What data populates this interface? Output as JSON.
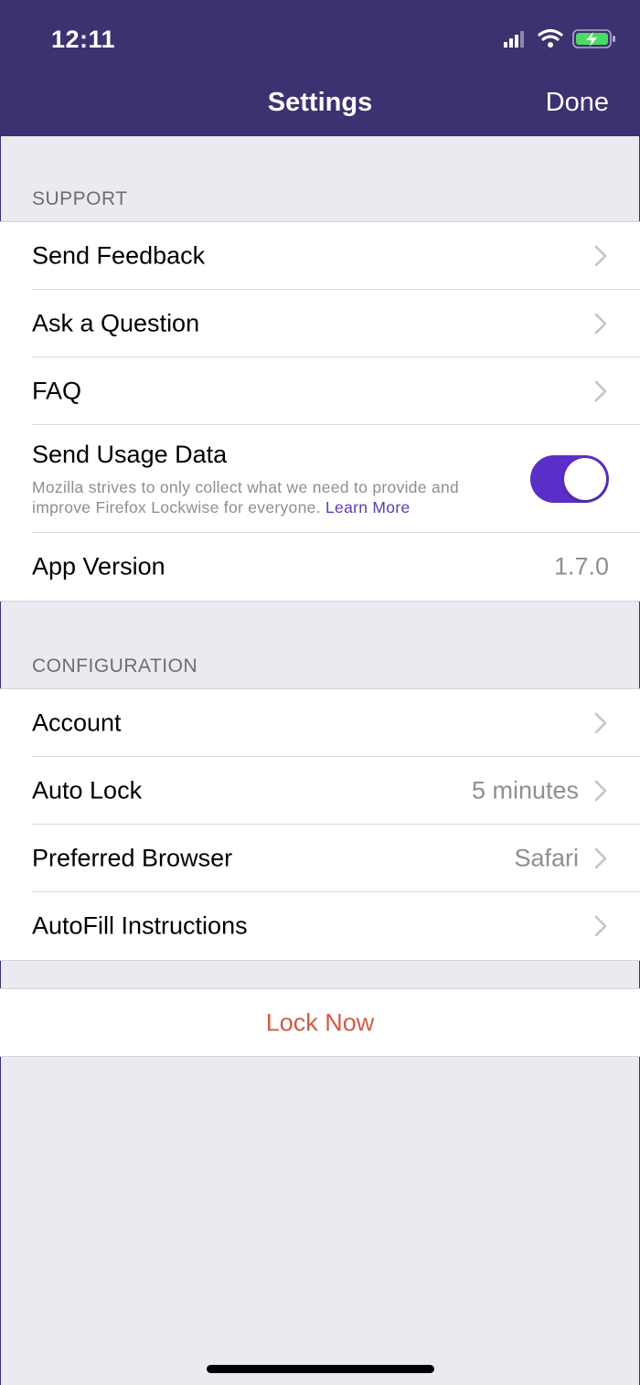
{
  "status_bar": {
    "time": "12:11"
  },
  "nav": {
    "title": "Settings",
    "done_label": "Done"
  },
  "support": {
    "header": "SUPPORT",
    "items": [
      {
        "label": "Send Feedback"
      },
      {
        "label": "Ask a Question"
      },
      {
        "label": "FAQ"
      }
    ],
    "usage": {
      "title": "Send Usage Data",
      "description": "Mozilla strives to only collect what we need to provide and improve Firefox Lockwise for everyone.",
      "learn_more": "Learn More",
      "enabled": true
    },
    "app_version": {
      "label": "App Version",
      "value": "1.7.0"
    }
  },
  "configuration": {
    "header": "CONFIGURATION",
    "items": [
      {
        "label": "Account",
        "value": ""
      },
      {
        "label": "Auto Lock",
        "value": "5 minutes"
      },
      {
        "label": "Preferred Browser",
        "value": "Safari"
      },
      {
        "label": "AutoFill Instructions",
        "value": ""
      }
    ]
  },
  "lock_now_label": "Lock Now",
  "colors": {
    "nav_background": "#3a3271",
    "toggle_on": "#5a2ec7",
    "lock_now": "#d35b43",
    "link": "#5b3bb5"
  }
}
